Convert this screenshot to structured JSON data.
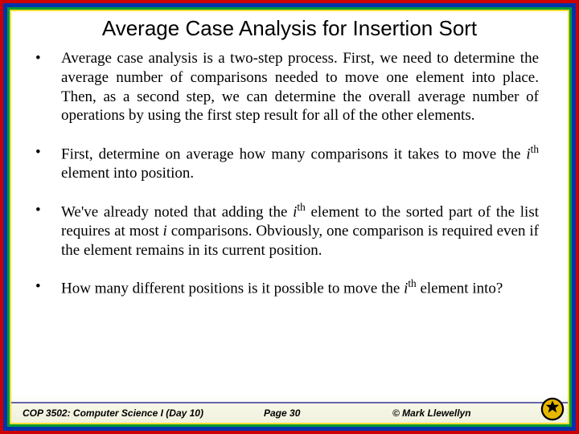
{
  "title": "Average Case Analysis for Insertion Sort",
  "bullets": {
    "b0": "Average case analysis is a two-step process. First, we need to determine the average number of comparisons needed to move one element into place. Then, as a second step, we can determine the overall average number of operations by using the first step result for all of the other elements.",
    "b1_pre": "First, determine on average how many comparisons it takes to move the ",
    "b1_i": "i",
    "b1_sup": "th",
    "b1_post": " element into position.",
    "b2_pre": "We've already noted that adding the ",
    "b2_i1": "i",
    "b2_sup1": "th",
    "b2_mid1": " element to the sorted part of the list requires at most ",
    "b2_i2": "i",
    "b2_mid2": " comparisons. Obviously, one comparison is required even if the element remains in its current position.",
    "b3_pre": "How many different positions is it possible to move the ",
    "b3_i": "i",
    "b3_sup": "th",
    "b3_post": " element into?"
  },
  "footer": {
    "left": "COP 3502: Computer Science I  (Day 10)",
    "mid": "Page 30",
    "right": "© Mark Llewellyn"
  },
  "bullet_marker": "•"
}
